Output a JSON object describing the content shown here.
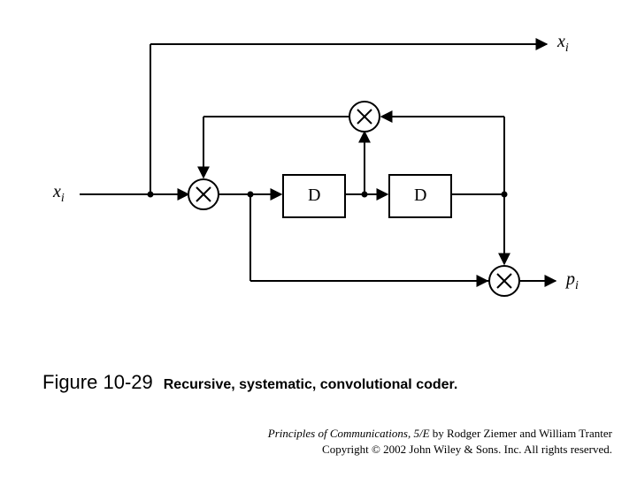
{
  "labels": {
    "input": "x",
    "input_sub": "i",
    "out_top": "x",
    "out_top_sub": "i",
    "out_bottom": "p",
    "out_bottom_sub": "i",
    "delay1": "D",
    "delay2": "D"
  },
  "caption": {
    "figure_number": "Figure 10-29",
    "title": "Recursive, systematic, convolutional coder."
  },
  "credit": {
    "book_title": "Principles of Communications, 5/E",
    "by_line": " by Rodger Ziemer and William Tranter",
    "copyright": "Copyright © 2002 John Wiley & Sons. Inc. All rights reserved."
  }
}
